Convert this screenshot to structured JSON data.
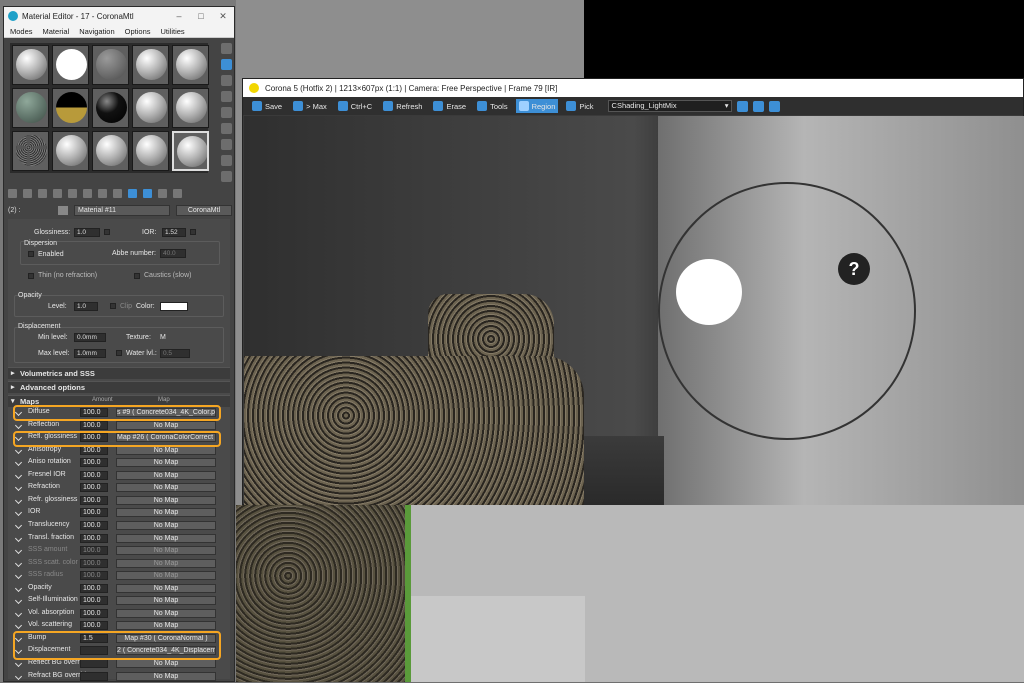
{
  "material_editor": {
    "title": "Material Editor - 17 - CoronaMtl",
    "menu": [
      "Modes",
      "Material",
      "Navigation",
      "Options",
      "Utilities"
    ],
    "slot_index": "(2) :",
    "material_name": "Material #11",
    "material_type": "CoronaMtl",
    "refraction": {
      "glossiness_label": "Glossiness:",
      "glossiness": "1.0",
      "ior_label": "IOR:",
      "ior": "1.52",
      "dispersion_label": "Dispersion",
      "enabled_label": "Enabled",
      "abbe_label": "Abbe number:",
      "abbe": "40.0",
      "thin_label": "Thin (no refraction)",
      "caustics_label": "Caustics (slow)"
    },
    "opacity": {
      "title": "Opacity",
      "level_label": "Level:",
      "level": "1.0",
      "clip_label": "Clip",
      "color_label": "Color:"
    },
    "displacement": {
      "title": "Displacement",
      "min_label": "Min level:",
      "min": "0.0mm",
      "texture_label": "Texture:",
      "texture": "M",
      "max_label": "Max level:",
      "max": "1.0mm",
      "water_label": "Water lvl.:",
      "water": "0.5"
    },
    "rollouts": {
      "vol": "Volumetrics and SSS",
      "adv": "Advanced options",
      "maps": "Maps"
    },
    "maps_headers": {
      "amount": "Amount",
      "map": "Map"
    },
    "maps": [
      {
        "name": "Diffuse",
        "amount": "100.0",
        "map": "s #9 ( Concrete034_4K_Color.pr",
        "enabled": true
      },
      {
        "name": "Reflection",
        "amount": "100.0",
        "map": "No Map",
        "enabled": true
      },
      {
        "name": "Refl. glossiness",
        "amount": "100.0",
        "map": "Map #26 ( CoronaColorCorrect )",
        "enabled": true
      },
      {
        "name": "Anisotropy",
        "amount": "100.0",
        "map": "No Map",
        "enabled": true
      },
      {
        "name": "Aniso rotation",
        "amount": "100.0",
        "map": "No Map",
        "enabled": true
      },
      {
        "name": "Fresnel IOR",
        "amount": "100.0",
        "map": "No Map",
        "enabled": true
      },
      {
        "name": "Refraction",
        "amount": "100.0",
        "map": "No Map",
        "enabled": true
      },
      {
        "name": "Refr. glossiness",
        "amount": "100.0",
        "map": "No Map",
        "enabled": true
      },
      {
        "name": "IOR",
        "amount": "100.0",
        "map": "No Map",
        "enabled": true
      },
      {
        "name": "Translucency",
        "amount": "100.0",
        "map": "No Map",
        "enabled": true
      },
      {
        "name": "Transl. fraction",
        "amount": "100.0",
        "map": "No Map",
        "enabled": true
      },
      {
        "name": "SSS amount",
        "amount": "100.0",
        "map": "No Map",
        "enabled": false
      },
      {
        "name": "SSS scatt. color",
        "amount": "100.0",
        "map": "No Map",
        "enabled": false
      },
      {
        "name": "SSS radius",
        "amount": "100.0",
        "map": "No Map",
        "enabled": false
      },
      {
        "name": "Opacity",
        "amount": "100.0",
        "map": "No Map",
        "enabled": true
      },
      {
        "name": "Self-Illumination",
        "amount": "100.0",
        "map": "No Map",
        "enabled": true
      },
      {
        "name": "Vol. absorption",
        "amount": "100.0",
        "map": "No Map",
        "enabled": true
      },
      {
        "name": "Vol. scattering",
        "amount": "100.0",
        "map": "No Map",
        "enabled": true
      },
      {
        "name": "Bump",
        "amount": "1.5",
        "map": "Map #30 ( CoronaNormal )",
        "enabled": true
      },
      {
        "name": "Displacement",
        "amount": "",
        "map": "2 ( Concrete034_4K_Displacemen",
        "enabled": true
      },
      {
        "name": "Reflect BG override",
        "amount": "",
        "map": "No Map",
        "enabled": true
      },
      {
        "name": "Refract BG override",
        "amount": "",
        "map": "No Map",
        "enabled": true
      }
    ]
  },
  "corona": {
    "title": "Corona 5 (Hotfix 2) | 1213×607px (1:1) | Camera: Free Perspective | Frame 79 [IR]",
    "toolbar": {
      "save": "Save",
      "max": "> Max",
      "ctrl_c": "Ctrl+C",
      "refresh": "Refresh",
      "erase": "Erase",
      "tools": "Tools",
      "region": "Region",
      "pick": "Pick",
      "pass": "CShading_LightMix"
    },
    "help_glyph": "?"
  },
  "accent": "#f5a623",
  "highlight_blue": "#3d8fd6"
}
